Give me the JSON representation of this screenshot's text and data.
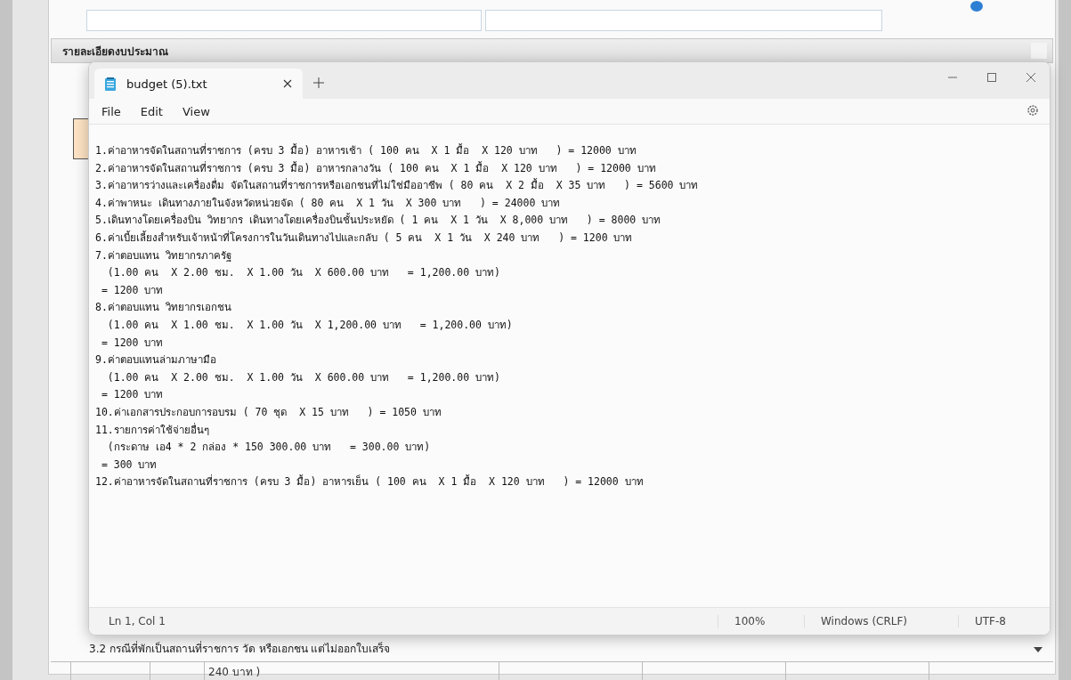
{
  "page": {
    "section_title": "รายละเอียดงบประมาณ",
    "note": "3.2 กรณีที่พักเป็นสถานที่ราชการ วัด หรือเอกชน แต่ไม่ออกใบเสร็จ",
    "table_cell": "240 บาท )"
  },
  "notepad": {
    "tabs": [
      {
        "label": "budget (5).txt",
        "selected": true
      }
    ],
    "menu": [
      "File",
      "Edit",
      "View"
    ],
    "lines": [
      "1.ค่าอาหารจัดในสถานที่ราชการ (ครบ 3 มื้อ) อาหารเช้า ( 100 คน  X 1 มื้อ  X 120 บาท   ) = 12000 บาท",
      "2.ค่าอาหารจัดในสถานที่ราชการ (ครบ 3 มื้อ) อาหารกลางวัน ( 100 คน  X 1 มื้อ  X 120 บาท   ) = 12000 บาท",
      "3.ค่าอาหารว่างและเครื่องดื่ม จัดในสถานที่ราชการหรือเอกชนที่ไม่ใช่มืออาชีพ ( 80 คน  X 2 มื้อ  X 35 บาท   ) = 5600 บาท",
      "4.ค่าพาหนะ เดินทางภายในจังหวัดหน่วยจัด ( 80 คน  X 1 วัน  X 300 บาท   ) = 24000 บาท",
      "5.เดินทางโดยเครื่องบิน วิทยากร เดินทางโดยเครื่องบินชั้นประหยัด ( 1 คน  X 1 วัน  X 8,000 บาท   ) = 8000 บาท",
      "6.ค่าเบี้ยเลี้ยงสำหรับเจ้าหน้าที่โครงการในวันเดินทางไปและกลับ ( 5 คน  X 1 วัน  X 240 บาท   ) = 1200 บาท",
      "7.ค่าตอบแทน วิทยากรภาครัฐ",
      "  (1.00 คน  X 2.00 ชม.  X 1.00 วัน  X 600.00 บาท   = 1,200.00 บาท)",
      " = 1200 บาท",
      "8.ค่าตอบแทน วิทยากรเอกชน",
      "  (1.00 คน  X 1.00 ชม.  X 1.00 วัน  X 1,200.00 บาท   = 1,200.00 บาท)",
      " = 1200 บาท",
      "9.ค่าตอบแทนล่ามภาษามือ",
      "  (1.00 คน  X 2.00 ชม.  X 1.00 วัน  X 600.00 บาท   = 1,200.00 บาท)",
      " = 1200 บาท",
      "10.ค่าเอกสารประกอบการอบรม ( 70 ชุด  X 15 บาท   ) = 1050 บาท",
      "11.รายการค่าใช้จ่ายอื่นๆ",
      "  (กระดาษ เอ4 * 2 กล่อง * 150 300.00 บาท   = 300.00 บาท)",
      " = 300 บาท",
      "12.ค่าอาหารจัดในสถานที่ราชการ (ครบ 3 มื้อ) อาหารเย็น ( 100 คน  X 1 มื้อ  X 120 บาท   ) = 12000 บาท"
    ],
    "status": [
      "Ln 1, Col 1",
      "100%",
      "Windows (CRLF)",
      "UTF-8"
    ]
  }
}
